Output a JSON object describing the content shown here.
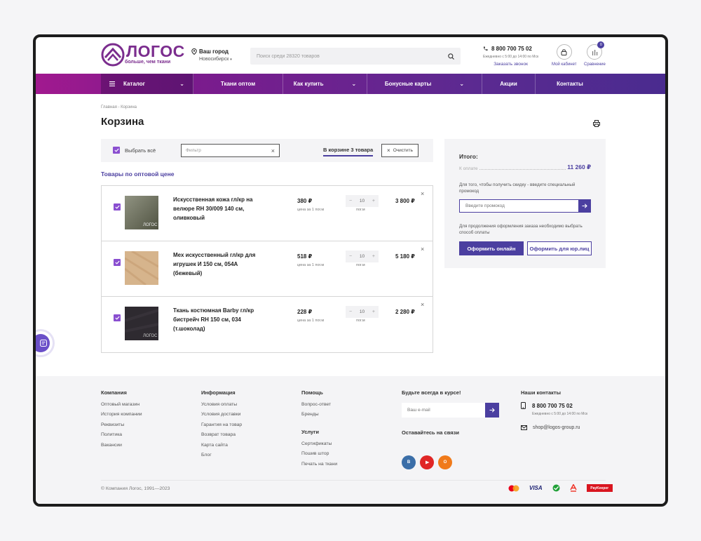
{
  "header": {
    "logo_name": "ЛОГОС",
    "logo_tagline": "больше, чем ткани",
    "city_label": "Ваш город",
    "city_name": "Новосибирск",
    "search_placeholder": "Поиск среди 28320 товаров",
    "phone": "8 800 700 75 02",
    "hours": "Ежедневно с 5:00 до 14:00 по Мск",
    "callback": "Заказать звонок",
    "account_label": "Мой кабинет",
    "compare_label": "Сравнение",
    "compare_count": "0"
  },
  "nav": {
    "items": [
      {
        "label": "Каталог"
      },
      {
        "label": "Ткани оптом"
      },
      {
        "label": "Как купить"
      },
      {
        "label": "Бонусные карты"
      },
      {
        "label": "Акции"
      },
      {
        "label": "Контакты"
      }
    ]
  },
  "page": {
    "breadcrumb": "Главная  -  Корзина",
    "title": "Корзина"
  },
  "toolbar": {
    "select_all": "Выбрать всё",
    "filter_placeholder": "Фильтр",
    "in_cart": "В корзине 3 товара",
    "clear": "Очистить"
  },
  "section_title": "Товары по оптовой цене",
  "cart_items": [
    {
      "name": "Искусственная кожа гл/кр на велюре RH 30/009 140 см, оливковый",
      "price": "380 ₽",
      "price_unit": "цена за 1 пог.м",
      "quantity": "10",
      "quantity_unit": "пог.м",
      "total": "3 800 ₽",
      "color": "#6b6f58"
    },
    {
      "name": "Мех искусственный гл/кр для игрушек И 150 см, 054А (бежевый)",
      "price": "518 ₽",
      "price_unit": "цена за 1 пог.м",
      "quantity": "10",
      "quantity_unit": "пог.м",
      "total": "5 180 ₽",
      "color": "#d6b48c"
    },
    {
      "name": "Ткань костюмная Barby гл/кр бистрейч RH 150 см, 034 (т.шоколад)",
      "price": "228 ₽",
      "price_unit": "цена за 1 пог.м",
      "quantity": "10",
      "quantity_unit": "пог.м",
      "total": "2 280 ₽",
      "color": "#2e2a30"
    }
  ],
  "summary": {
    "title": "Итого:",
    "to_pay_label": "К оплате",
    "to_pay_value": "11 260 ₽",
    "promo_note": "Для того, чтобы получить скидку - введите специальный промокод",
    "promo_placeholder": "Введите промокод",
    "pay_note": "Для продолжения оформления заказа необходимо выбрать способ оплаты",
    "btn_online": "Оформить онлайн",
    "btn_legal": "Оформить для юр.лиц"
  },
  "footer": {
    "company": {
      "title": "Компания",
      "links": [
        "Оптовый магазин",
        "История компании",
        "Реквизиты",
        "Политика",
        "Вакансии"
      ]
    },
    "info": {
      "title": "Информация",
      "links": [
        "Условия оплаты",
        "Условия доставки",
        "Гарантия на товар",
        "Возврат товара",
        "Карта сайта",
        "Блог"
      ]
    },
    "help": {
      "title": "Помощь",
      "links": [
        "Вопрос-ответ",
        "Бренды"
      ]
    },
    "services": {
      "title": "Услуги",
      "links": [
        "Сертификаты",
        "Пошив штор",
        "Печать на ткани"
      ]
    },
    "subscribe_title": "Будьте всегда в курсе!",
    "email_placeholder": "Ваш e-mail",
    "social_title": "Оставайтесь на связи",
    "contacts_title": "Наши контакты",
    "phone": "8 800 700 75 02",
    "hours": "Ежедневно с 5:00 до 14:00 по Мск",
    "email": "shop@logos-group.ru",
    "copyright": "© Компания Логос, 1991—2023",
    "visa": "VISA",
    "paykeeper": "PayKeeper"
  },
  "colors": {
    "accent": "#4b3fa0",
    "brand": "#7b2d8e",
    "checkbox": "#8a4fd0"
  }
}
